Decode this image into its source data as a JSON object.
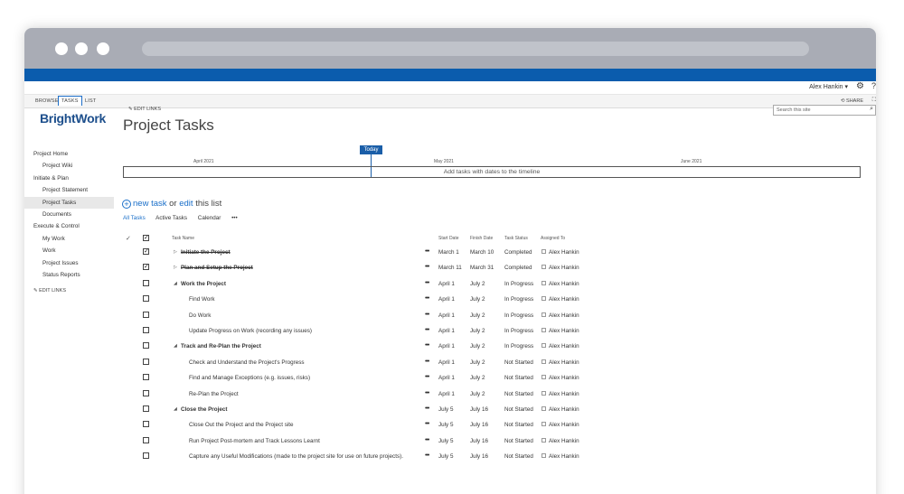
{
  "suite": {
    "user": "Alex Hankin"
  },
  "ribbon": {
    "tabs": [
      "BROWSE",
      "TASKS",
      "LIST"
    ],
    "active": "TASKS",
    "share": "SHARE"
  },
  "logo": "BrightWork",
  "nav": {
    "items": [
      {
        "label": "Project Home",
        "level": 0
      },
      {
        "label": "Project Wiki",
        "level": 1
      },
      {
        "label": "Initiate & Plan",
        "level": 0
      },
      {
        "label": "Project Statement",
        "level": 1
      },
      {
        "label": "Project Tasks",
        "level": 1,
        "selected": true
      },
      {
        "label": "Documents",
        "level": 1
      },
      {
        "label": "Execute & Control",
        "level": 0
      },
      {
        "label": "My Work",
        "level": 1
      },
      {
        "label": "Work",
        "level": 1
      },
      {
        "label": "Project Issues",
        "level": 1
      },
      {
        "label": "Status Reports",
        "level": 1
      }
    ],
    "edit_links": "EDIT LINKS"
  },
  "page": {
    "edit_links": "EDIT LINKS",
    "title": "Project Tasks",
    "search_placeholder": "Search this site"
  },
  "timeline": {
    "today": "Today",
    "months": [
      "April 2021",
      "May 2021",
      "June 2021"
    ],
    "empty_text": "Add tasks with dates to the timeline"
  },
  "list": {
    "new_task": "new task",
    "or": "or",
    "edit": "edit",
    "this_list": "this list",
    "views": [
      "All Tasks",
      "Active Tasks",
      "Calendar",
      "•••"
    ],
    "columns": {
      "name": "Task Name",
      "start": "Start Date",
      "finish": "Finish Date",
      "status": "Task Status",
      "assigned": "Assigned To"
    }
  },
  "tasks": [
    {
      "name": "Initiate the Project",
      "checked": true,
      "summary": true,
      "collapsed": true,
      "done": true,
      "start": "March 1",
      "finish": "March 10",
      "status": "Completed",
      "assigned": "Alex Hankin"
    },
    {
      "name": "Plan and Setup the Project",
      "checked": true,
      "summary": true,
      "collapsed": true,
      "done": true,
      "start": "March 11",
      "finish": "March 31",
      "status": "Completed",
      "assigned": "Alex Hankin"
    },
    {
      "name": "Work the Project",
      "checked": false,
      "summary": true,
      "collapsed": false,
      "start": "April 1",
      "finish": "July 2",
      "status": "In Progress",
      "assigned": "Alex Hankin"
    },
    {
      "name": "Find Work",
      "checked": false,
      "start": "April 1",
      "finish": "July 2",
      "status": "In Progress",
      "assigned": "Alex Hankin"
    },
    {
      "name": "Do Work",
      "checked": false,
      "start": "April 1",
      "finish": "July 2",
      "status": "In Progress",
      "assigned": "Alex Hankin"
    },
    {
      "name": "Update Progress on Work (recording any issues)",
      "checked": false,
      "start": "April 1",
      "finish": "July 2",
      "status": "In Progress",
      "assigned": "Alex Hankin"
    },
    {
      "name": "Track and Re-Plan the Project",
      "checked": false,
      "summary": true,
      "collapsed": false,
      "start": "April 1",
      "finish": "July 2",
      "status": "In Progress",
      "assigned": "Alex Hankin"
    },
    {
      "name": "Check and Understand the Project's Progress",
      "checked": false,
      "start": "April 1",
      "finish": "July 2",
      "status": "Not Started",
      "assigned": "Alex Hankin"
    },
    {
      "name": "Find and Manage Exceptions (e.g. issues, risks)",
      "checked": false,
      "start": "April 1",
      "finish": "July 2",
      "status": "Not Started",
      "assigned": "Alex Hankin"
    },
    {
      "name": "Re-Plan the Project",
      "checked": false,
      "start": "April 1",
      "finish": "July 2",
      "status": "Not Started",
      "assigned": "Alex Hankin"
    },
    {
      "name": "Close the Project",
      "checked": false,
      "summary": true,
      "collapsed": false,
      "start": "July 5",
      "finish": "July 16",
      "status": "Not Started",
      "assigned": "Alex Hankin"
    },
    {
      "name": "Close Out the Project and the Project site",
      "checked": false,
      "start": "July 5",
      "finish": "July 16",
      "status": "Not Started",
      "assigned": "Alex Hankin"
    },
    {
      "name": "Run Project Post-mortem and Track Lessons Learnt",
      "checked": false,
      "start": "July 5",
      "finish": "July 16",
      "status": "Not Started",
      "assigned": "Alex Hankin"
    },
    {
      "name": "Capture any Useful Modifications (made to the project site for use on future projects).",
      "checked": false,
      "start": "July 5",
      "finish": "July 16",
      "status": "Not Started",
      "assigned": "Alex Hankin"
    }
  ]
}
